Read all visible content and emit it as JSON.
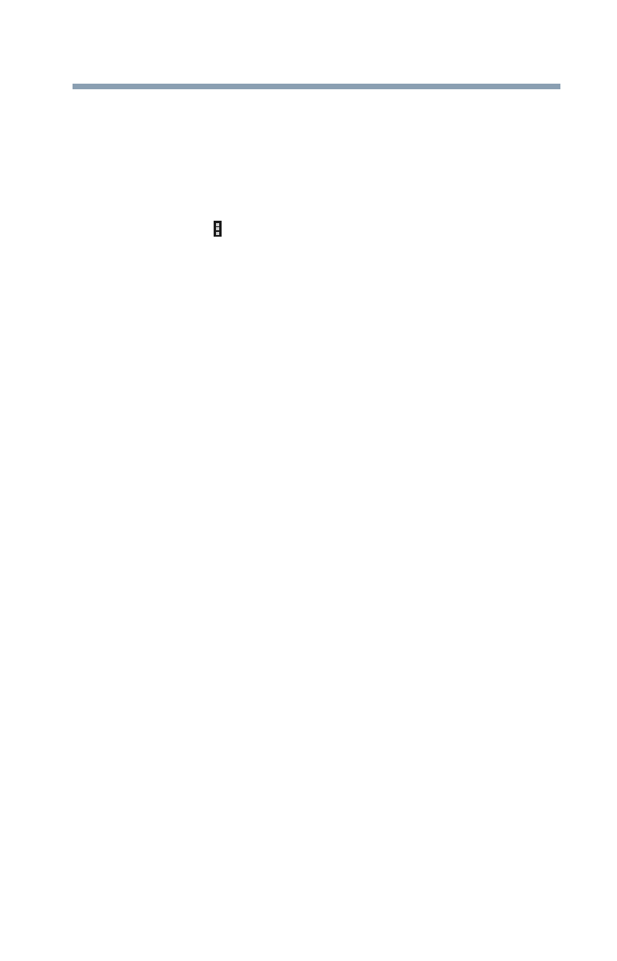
{
  "page": {
    "header_rule_color": "#8a9fb2"
  },
  "icons": {
    "menu": "menu-overflow-icon",
    "menu_color": "#1a1a1a"
  }
}
